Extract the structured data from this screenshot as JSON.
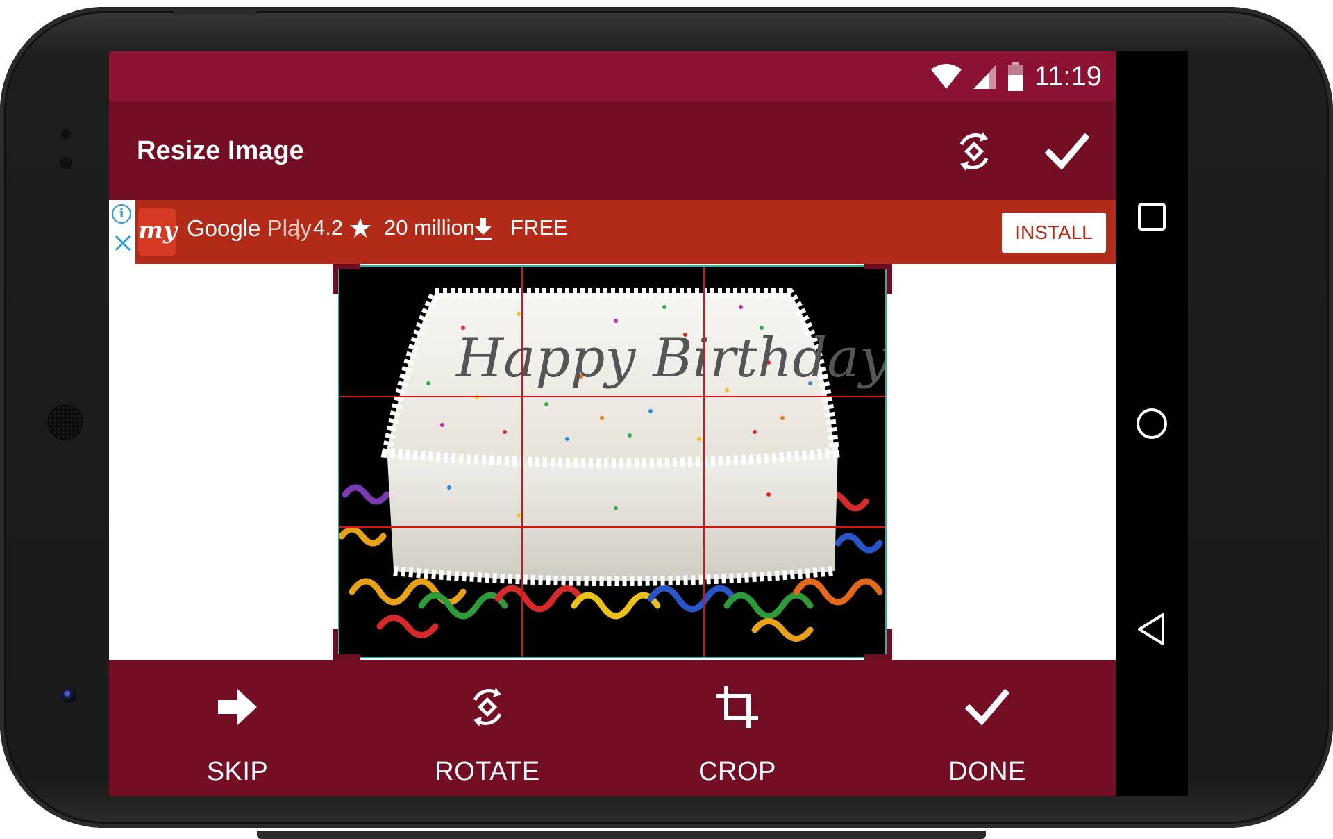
{
  "status_bar": {
    "time": "11:19",
    "icons": [
      "wifi-icon",
      "signal-icon",
      "battery-icon"
    ]
  },
  "app_bar": {
    "title": "Resize Image",
    "actions": [
      "rotate-icon",
      "check-icon"
    ]
  },
  "ad": {
    "logo_text": "my",
    "store_name": "Google",
    "store_name_suffix": "Play",
    "rating": "4.2",
    "downloads": "20 million",
    "price": "FREE",
    "install_label": "INSTALL",
    "info_glyph": "i"
  },
  "editor": {
    "image_subject": "birthday-cake-photo",
    "cake_text": "Happy Birthday",
    "grid": "rule-of-thirds"
  },
  "bottom_toolbar": {
    "tools": [
      {
        "label": "SKIP",
        "icon": "arrow-right-icon"
      },
      {
        "label": "ROTATE",
        "icon": "rotate-icon"
      },
      {
        "label": "CROP",
        "icon": "crop-icon"
      },
      {
        "label": "DONE",
        "icon": "check-icon"
      }
    ]
  },
  "nav_bar": {
    "buttons": [
      "recents-square-icon",
      "home-circle-icon",
      "back-triangle-icon"
    ]
  },
  "colors": {
    "status_bar": "#8c1233",
    "app_bar": "#730e24",
    "ad_banner": "#b22b18",
    "grid_lines": "#e01010",
    "crop_border": "#2bb3a0"
  }
}
